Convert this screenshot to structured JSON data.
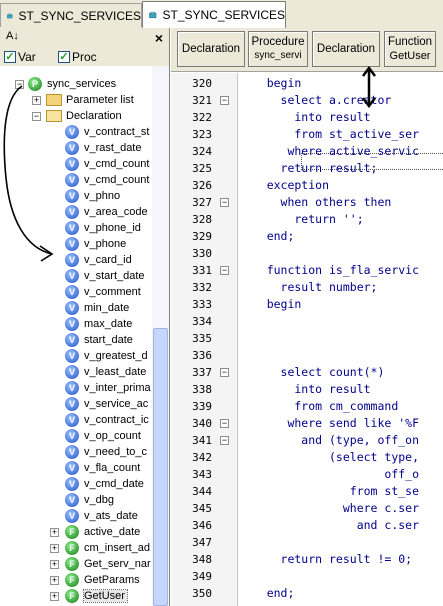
{
  "tabs": [
    {
      "label": "ST_SYNC_SERVICES",
      "active": false
    },
    {
      "label": "ST_SYNC_SERVICES",
      "active": true
    }
  ],
  "left_toolbar": {
    "sort_label": "A↓",
    "close": "×"
  },
  "filters": [
    {
      "label": "Var",
      "checked": true
    },
    {
      "label": "Proc",
      "checked": true
    }
  ],
  "tree": {
    "root": "sync_services",
    "folders": [
      "Parameter list",
      "Declaration"
    ],
    "variables": [
      "v_contract_st",
      "v_rast_date",
      "v_cmd_count",
      "v_cmd_count",
      "v_phno",
      "v_area_code",
      "v_phone_id",
      "v_phone",
      "v_card_id",
      "v_start_date",
      "v_comment",
      "min_date",
      "max_date",
      "start_date",
      "v_greatest_d",
      "v_least_date",
      "v_inter_prima",
      "v_service_ac",
      "v_contract_ic",
      "v_op_count",
      "v_need_to_c",
      "v_fla_count",
      "v_cmd_date",
      "v_dbg",
      "v_ats_date"
    ],
    "functions": [
      "active_date",
      "cm_insert_ad",
      "Get_serv_nar",
      "GetParams",
      "GetUser"
    ]
  },
  "right_toolbar": [
    {
      "label": "Declaration",
      "sub": ""
    },
    {
      "label": "Procedure",
      "sub": "sync_servi"
    },
    {
      "label": "Declaration",
      "sub": ""
    },
    {
      "label": "Function",
      "sub": "GetUser"
    }
  ],
  "code_lines": [
    {
      "n": "320",
      "fold": "",
      "text": "    begin"
    },
    {
      "n": "321",
      "fold": "−",
      "text": "      select a.creator"
    },
    {
      "n": "322",
      "fold": "",
      "text": "        into result"
    },
    {
      "n": "323",
      "fold": "",
      "text": "        from st_active_ser"
    },
    {
      "n": "324",
      "fold": "",
      "text": "       where active_servic"
    },
    {
      "n": "325",
      "fold": "",
      "text": "      return result;"
    },
    {
      "n": "326",
      "fold": "",
      "text": "    exception"
    },
    {
      "n": "327",
      "fold": "−",
      "text": "      when others then"
    },
    {
      "n": "328",
      "fold": "",
      "text": "        return '';"
    },
    {
      "n": "329",
      "fold": "",
      "text": "    end;"
    },
    {
      "n": "330",
      "fold": "",
      "text": ""
    },
    {
      "n": "331",
      "fold": "−",
      "text": "    function is_fla_servic"
    },
    {
      "n": "332",
      "fold": "",
      "text": "      result number;"
    },
    {
      "n": "333",
      "fold": "",
      "text": "    begin"
    },
    {
      "n": "334",
      "fold": "",
      "text": ""
    },
    {
      "n": "335",
      "fold": "",
      "text": ""
    },
    {
      "n": "336",
      "fold": "",
      "text": ""
    },
    {
      "n": "337",
      "fold": "−",
      "text": "      select count(*)"
    },
    {
      "n": "338",
      "fold": "",
      "text": "        into result"
    },
    {
      "n": "339",
      "fold": "",
      "text": "        from cm_command"
    },
    {
      "n": "340",
      "fold": "−",
      "text": "       where send like '%F"
    },
    {
      "n": "341",
      "fold": "−",
      "text": "         and (type, off_on"
    },
    {
      "n": "342",
      "fold": "",
      "text": "             (select type,"
    },
    {
      "n": "343",
      "fold": "",
      "text": "                     off_o"
    },
    {
      "n": "344",
      "fold": "",
      "text": "                from st_se"
    },
    {
      "n": "345",
      "fold": "",
      "text": "               where c.ser"
    },
    {
      "n": "346",
      "fold": "",
      "text": "                 and c.ser"
    },
    {
      "n": "347",
      "fold": "",
      "text": ""
    },
    {
      "n": "348",
      "fold": "",
      "text": "      return result != 0;"
    },
    {
      "n": "349",
      "fold": "",
      "text": ""
    },
    {
      "n": "350",
      "fold": "",
      "text": "    end;"
    }
  ],
  "colors": {
    "toolbar_bg": "#ece9d8",
    "code_fg": "#00008b",
    "accent": "#1d4fc9"
  },
  "icons": [
    "sort-icon",
    "close-icon",
    "variable-icon",
    "function-icon",
    "folder-icon",
    "package-icon",
    "fold-toggle-icon"
  ]
}
